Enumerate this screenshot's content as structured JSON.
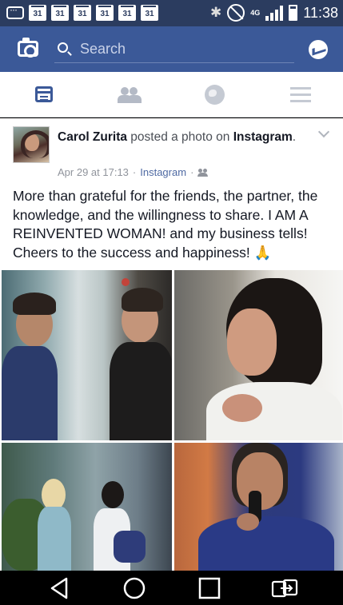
{
  "status_bar": {
    "calendar_day": "31",
    "network": "4G",
    "time": "11:38"
  },
  "app_bar": {
    "search_placeholder": "Search"
  },
  "tabs": [
    "news-feed",
    "friends",
    "notifications",
    "menu"
  ],
  "post": {
    "author": "Carol Zurita",
    "action": " posted a photo on ",
    "page": "Instagram",
    "page_suffix": ".",
    "date": "Apr 29 at 17:13",
    "separator": "·",
    "source": "Instagram",
    "text": "More than grateful for the friends, the partner, the knowledge, and the willingness to share. I AM A REINVENTED WOMAN! and my business tells! Cheers to the success and happiness! 🙏"
  },
  "colors": {
    "status_bar": "#2b3c5f",
    "brand": "#3b5998",
    "nav_bar": "#000000"
  }
}
